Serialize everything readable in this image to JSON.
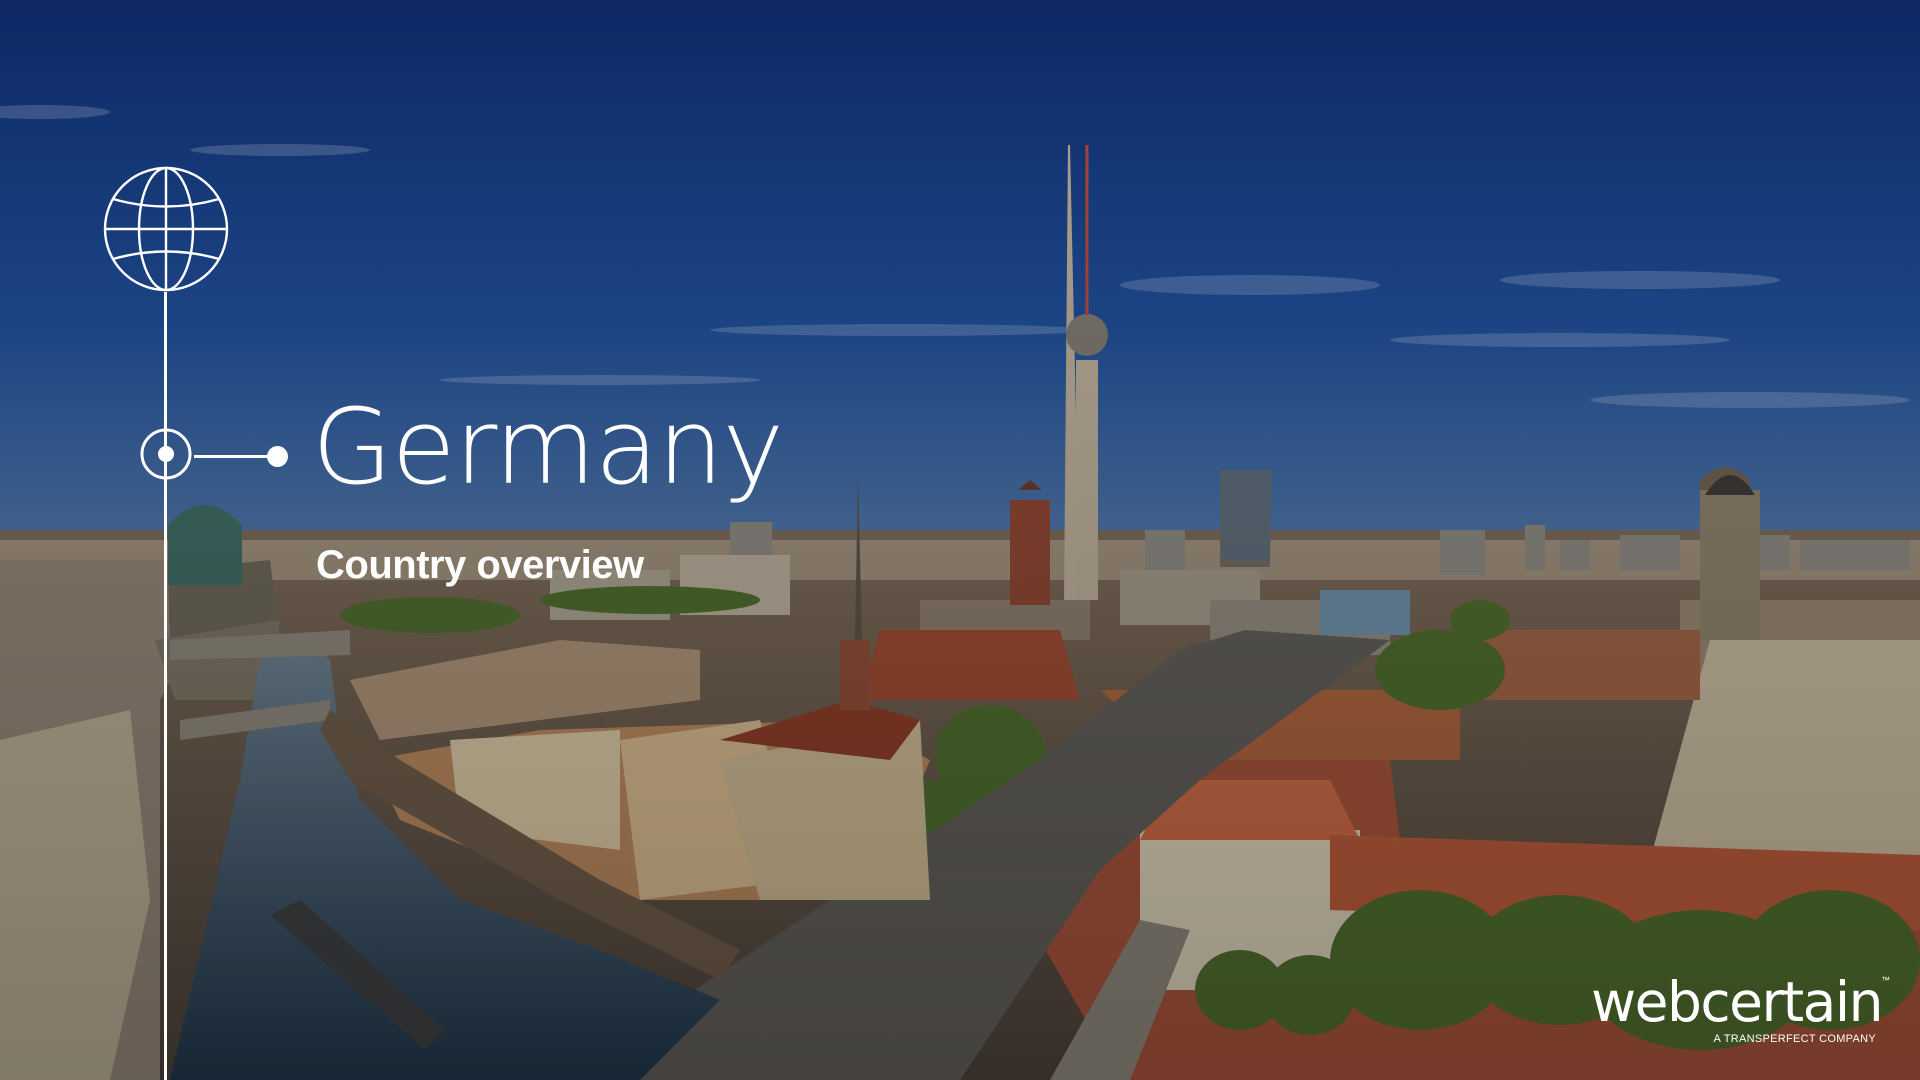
{
  "slide": {
    "title": "Germany",
    "subtitle": "Country overview"
  },
  "branding": {
    "logo_text": "webcertain",
    "logo_tagline": "A TRANSPERFECT COMPANY",
    "trademark": "™"
  },
  "icons": {
    "globe": "globe-icon",
    "node": "timeline-node-icon"
  },
  "colors": {
    "text": "#ffffff",
    "sky_top": "#0f2a6e",
    "sky_horizon": "#d9a878",
    "river": "#2c4a63",
    "roof_red": "#b04a2c"
  }
}
